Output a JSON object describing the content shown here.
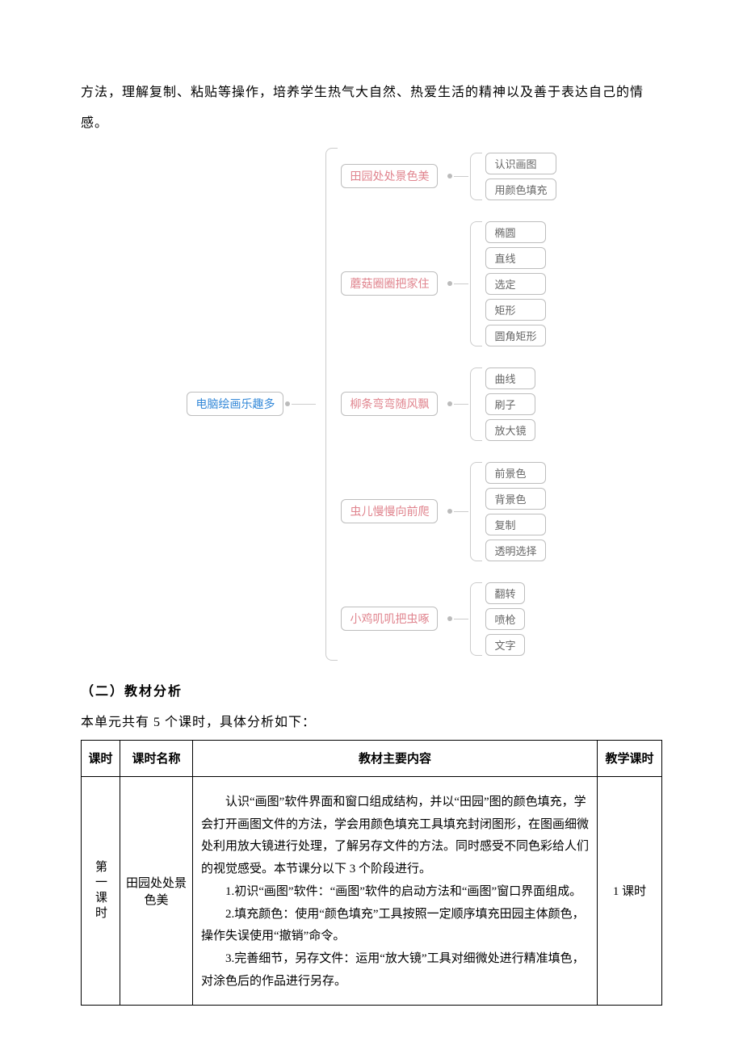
{
  "intro": "方法，理解复制、粘贴等操作，培养学生热气大自然、热爱生活的精神以及善于表达自己的情感。",
  "mindmap": {
    "root": "电脑绘画乐趣多",
    "groups": [
      {
        "label": "田园处处景色美",
        "leaves": [
          "认识画图",
          "用颜色填充"
        ]
      },
      {
        "label": "蘑菇圈圈把家住",
        "leaves": [
          "椭圆",
          "直线",
          "选定",
          "矩形",
          "圆角矩形"
        ]
      },
      {
        "label": "柳条弯弯随风飘",
        "leaves": [
          "曲线",
          "刷子",
          "放大镜"
        ]
      },
      {
        "label": "虫儿慢慢向前爬",
        "leaves": [
          "前景色",
          "背景色",
          "复制",
          "透明选择"
        ]
      },
      {
        "label": "小鸡叽叽把虫啄",
        "leaves": [
          "翻转",
          "喷枪",
          "文字"
        ]
      }
    ]
  },
  "section_heading": "（二）教材分析",
  "section_sub": "本单元共有 5 个课时，具体分析如下：",
  "table": {
    "headers": [
      "课时",
      "课时名称",
      "教材主要内容",
      "教学课时"
    ],
    "row1": {
      "period": "第一课时",
      "name": "田园处处景色美",
      "content": [
        "认识“画图”软件界面和窗口组成结构，并以“田园”图的颜色填充，学会打开画图文件的方法，学会用颜色填充工具填充封闭图形，在图画细微处利用放大镜进行处理，了解另存文件的方法。同时感受不同色彩给人们的视觉感受。本节课分以下 3 个阶段进行。",
        "1.初识“画图”软件：“画图”软件的启动方法和“画图”窗口界面组成。",
        "2.填充颜色：使用“颜色填充”工具按照一定顺序填充田园主体颜色，操作失误使用“撤销”命令。",
        "3.完善细节，另存文件：运用“放大镜”工具对细微处进行精准填色，对涂色后的作品进行另存。"
      ],
      "hours": "1 课时"
    }
  }
}
